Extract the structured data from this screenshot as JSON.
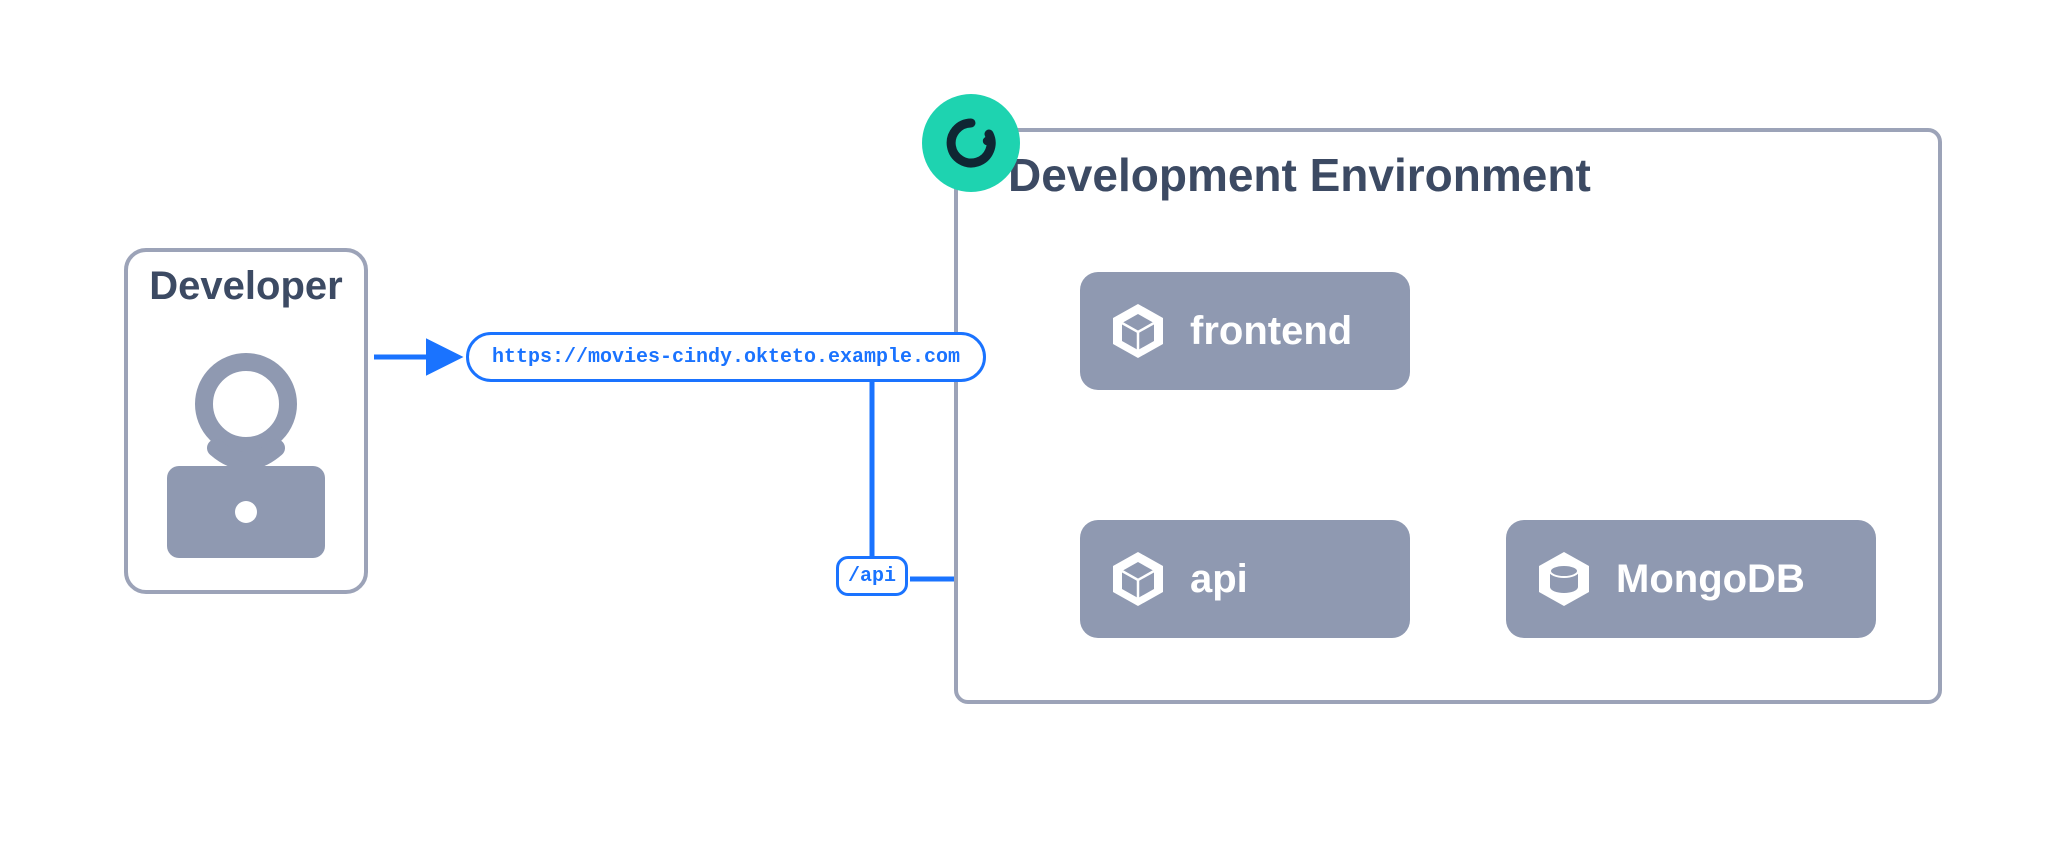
{
  "developer": {
    "title": "Developer"
  },
  "environment": {
    "title": "Development Environment"
  },
  "url": "https://movies-cindy.okteto.example.com",
  "api_path": "/api",
  "nodes": {
    "frontend": {
      "label": "frontend"
    },
    "api": {
      "label": "api"
    },
    "mongo": {
      "label": "MongoDB"
    }
  }
}
